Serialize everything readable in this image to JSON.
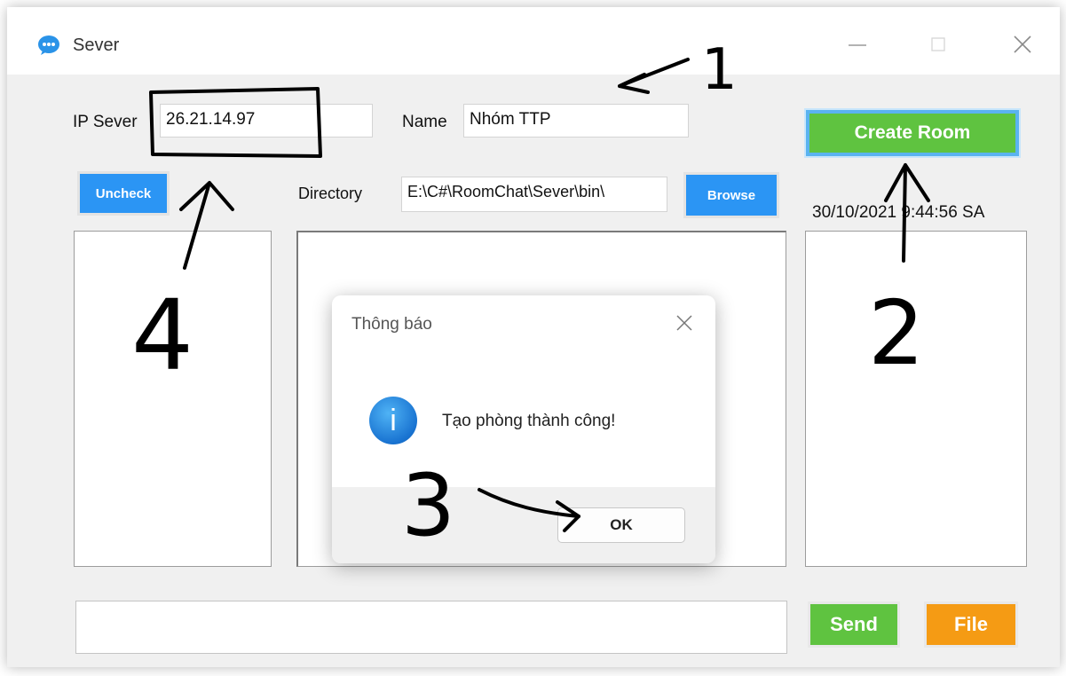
{
  "window": {
    "title": "Sever",
    "icons": [
      "chat-bubble-icon",
      "minimize-icon",
      "maximize-icon",
      "close-icon"
    ]
  },
  "form": {
    "ip_label": "IP Sever",
    "ip_value": "26.21.14.97",
    "name_label": "Name",
    "name_value": "Nhóm TTP",
    "create_room_label": "Create Room",
    "uncheck_label": "Uncheck",
    "directory_label": "Directory",
    "directory_value": "E:\\C#\\RoomChat\\Sever\\bin\\",
    "browse_label": "Browse",
    "timestamp": "30/10/2021 9:44:56 SA",
    "message_value": "",
    "send_label": "Send",
    "file_label": "File"
  },
  "dialog": {
    "title": "Thông báo",
    "message": "Tạo phòng thành công!",
    "icon_glyph": "i",
    "ok_label": "OK"
  },
  "annotations": {
    "labels": [
      "1",
      "2",
      "3",
      "4"
    ],
    "color": "#000000"
  },
  "colors": {
    "button_blue": "#2b95f4",
    "button_green": "#5fc340",
    "button_orange": "#f59b14",
    "dialog_icon": "#1973d1"
  }
}
